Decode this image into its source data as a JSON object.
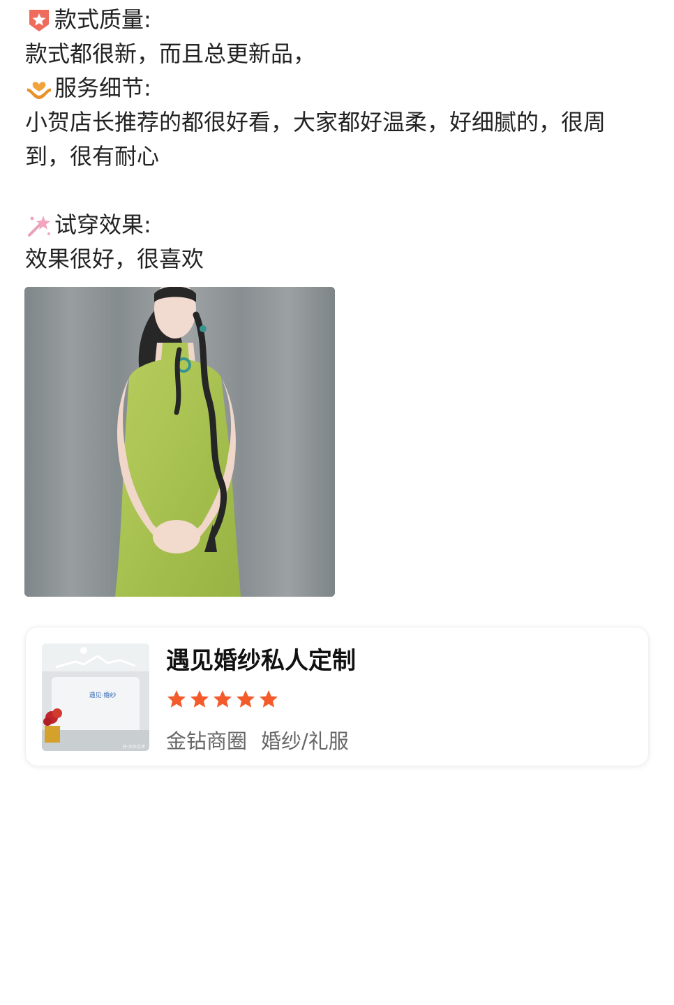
{
  "review": {
    "quality_heading": "款式质量:",
    "quality_text": "款式都很新，而且总更新品，",
    "service_heading": "服务细节:",
    "service_text": "小贺店长推荐的都很好看，大家都好温柔，好细腻的，很周到，很有耐心",
    "effect_heading": "试穿效果:",
    "effect_text": "效果很好，很喜欢"
  },
  "icons": {
    "quality": "star-badge-icon",
    "service": "heart-hands-icon",
    "effect": "sparkle-wand-icon"
  },
  "shop": {
    "name": "遇见婚纱私人定制",
    "rating": 5,
    "area": "金钻商圈",
    "category": "婚纱/礼服",
    "thumb_sign": "遇见·婚纱",
    "thumb_watermark": "扑·大众点评"
  },
  "colors": {
    "star": "#f45b2b",
    "badge": "#ef6b5b",
    "hands": "#f2a33a",
    "dress": "#a8c24a"
  }
}
